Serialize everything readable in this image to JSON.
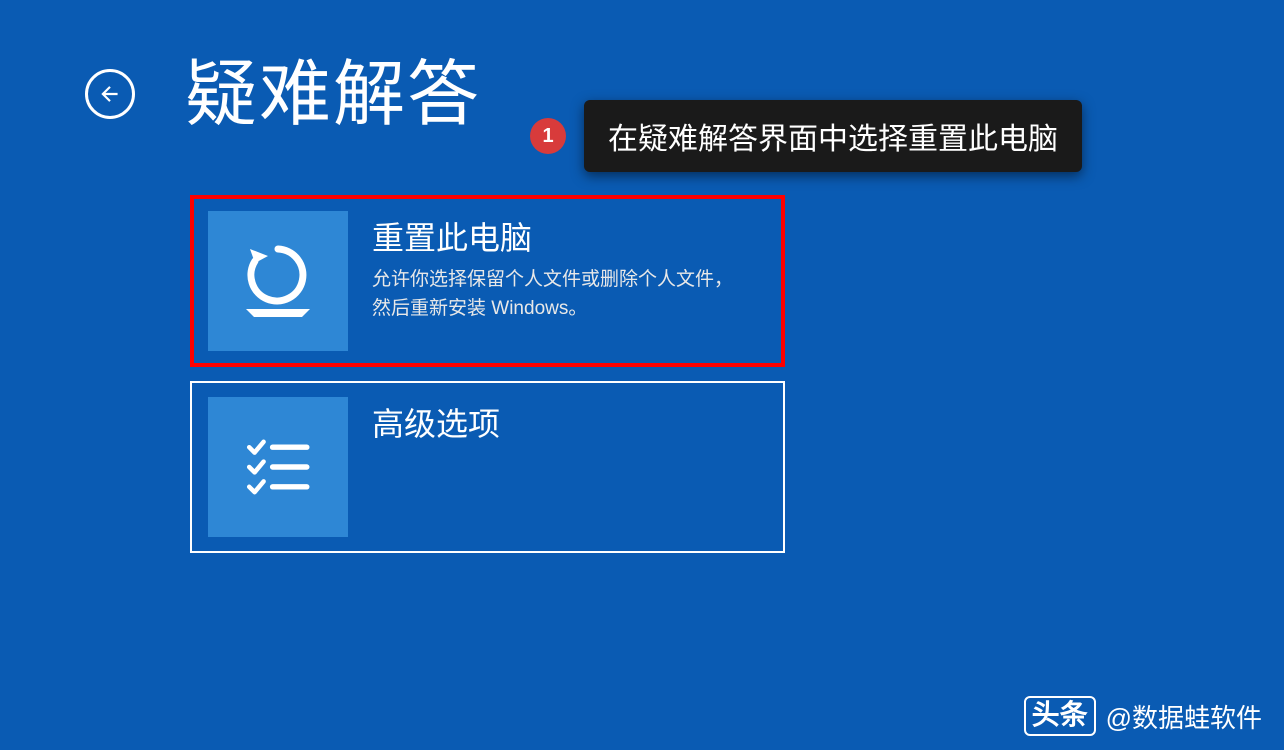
{
  "page": {
    "title": "疑难解答"
  },
  "annotation": {
    "number": "1",
    "text": "在疑难解答界面中选择重置此电脑"
  },
  "options": [
    {
      "title": "重置此电脑",
      "description": "允许你选择保留个人文件或删除个人文件，然后重新安装 Windows。",
      "highlighted": true
    },
    {
      "title": "高级选项",
      "description": "",
      "highlighted": false
    }
  ],
  "watermark": {
    "logo": "头条",
    "text": "@数据蛙软件"
  }
}
